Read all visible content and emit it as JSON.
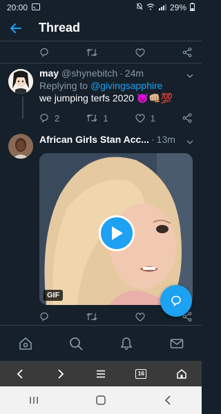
{
  "status": {
    "time": "20:00",
    "battery": "29%"
  },
  "header": {
    "title": "Thread"
  },
  "tweets": [
    {
      "name": "may",
      "handle": "@shynebitch",
      "dot": "·",
      "time": "24m",
      "reply_prefix": "Replying to",
      "reply_to": "@givingsapphire",
      "text": "we jumping terfs 2020 😈👊🏼💯",
      "reply_count": "2",
      "retweet_count": "1",
      "like_count": "1"
    },
    {
      "name": "African Girls Stan Acc...",
      "dot": "·",
      "time": "13m",
      "media_badge": "GIF"
    }
  ],
  "browser": {
    "tab_count": "16"
  },
  "colors": {
    "background": "#15202b",
    "accent": "#1da1f2",
    "muted": "#8899a6",
    "divider": "#38444d"
  }
}
